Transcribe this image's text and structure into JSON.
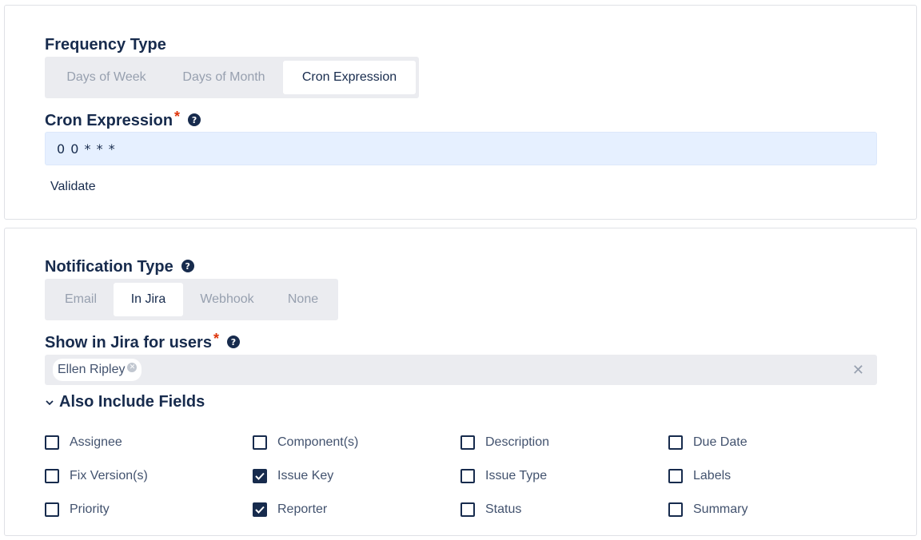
{
  "frequency": {
    "label": "Frequency Type",
    "options": [
      "Days of Week",
      "Days of Month",
      "Cron Expression"
    ],
    "selected": "Cron Expression"
  },
  "cron": {
    "label": "Cron Expression",
    "required_mark": "*",
    "help_icon": "question-circle-icon",
    "value": "0 0 * * *",
    "validate_label": "Validate"
  },
  "notification": {
    "label": "Notification Type",
    "help_icon": "question-circle-icon",
    "options": [
      "Email",
      "In Jira",
      "Webhook",
      "None"
    ],
    "selected": "In Jira"
  },
  "users": {
    "label": "Show in Jira for users",
    "required_mark": "*",
    "help_icon": "question-circle-icon",
    "selected": [
      "Ellen Ripley"
    ],
    "clear_icon": "close-icon"
  },
  "fields": {
    "toggle_label": "Also Include Fields",
    "toggle_icon": "chevron-down-icon",
    "items": [
      {
        "label": "Assignee",
        "checked": false
      },
      {
        "label": "Component(s)",
        "checked": false
      },
      {
        "label": "Description",
        "checked": false
      },
      {
        "label": "Due Date",
        "checked": false
      },
      {
        "label": "Fix Version(s)",
        "checked": false
      },
      {
        "label": "Issue Key",
        "checked": true
      },
      {
        "label": "Issue Type",
        "checked": false
      },
      {
        "label": "Labels",
        "checked": false
      },
      {
        "label": "Priority",
        "checked": false
      },
      {
        "label": "Reporter",
        "checked": true
      },
      {
        "label": "Status",
        "checked": false
      },
      {
        "label": "Summary",
        "checked": false
      }
    ]
  },
  "colors": {
    "text": "#172b4d",
    "required": "#de350b",
    "segment_bg": "#ebecf0",
    "input_bg": "#e6f0ff"
  }
}
